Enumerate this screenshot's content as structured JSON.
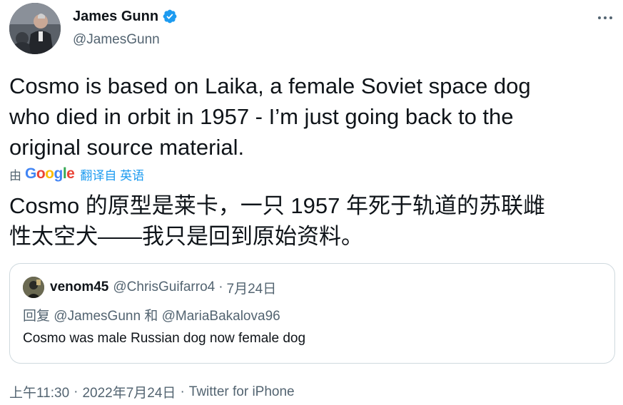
{
  "author": {
    "display_name": "James Gunn",
    "handle": "@JamesGunn"
  },
  "tweet": {
    "text_line1": "Cosmo is based on Laika, a female Soviet space dog",
    "text_line2": "who died in orbit in 1957 - I’m just going back to the",
    "text_line3": "original source material.",
    "translated_by": "由",
    "google_letters": [
      "G",
      "o",
      "o",
      "g",
      "l",
      "e"
    ],
    "translate_link": "翻译自 英语",
    "translated_line1": "Cosmo 的原型是莱卡，一只 1957 年死于轨道的苏联雌",
    "translated_line2": "性太空犬——我只是回到原始资料。"
  },
  "quote": {
    "display_name": "venom45",
    "handle": "@ChrisGuifarro4",
    "separator": "·",
    "date": "7月24日",
    "reply_prefix": "回复",
    "reply_mention1": "@JamesGunn",
    "reply_and": "和",
    "reply_mention2": "@MariaBakalova96",
    "text": "Cosmo was male Russian dog now female dog"
  },
  "footer": {
    "time": "上午11:30",
    "separator1": "·",
    "date": "2022年7月24日",
    "separator2": "·",
    "source": "Twitter for iPhone"
  },
  "colors": {
    "verified": "#1d9bf0",
    "link": "#1d9bf0",
    "secondary_text": "#536471",
    "border": "#cfd9de"
  },
  "icons": {
    "verified": "verified-badge-icon",
    "more": "more-options-icon"
  }
}
